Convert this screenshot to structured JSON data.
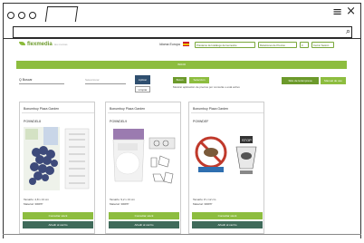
{
  "browser": {
    "menu_glyph": "≡",
    "close_glyph": "×",
    "search_glyph": "⌕"
  },
  "header": {
    "logo_text": "flexmedia",
    "tagline": "las marcas",
    "lang_label": "Idioma Europa",
    "buttons": [
      "Préstamo del catálogo del semestre",
      "Relaciones de Precios",
      "0",
      "Cerrar Sesión"
    ]
  },
  "banner_title": "INICIO",
  "filters": {
    "search_label": "Q  Buscar",
    "category_placeholder": "Seleccionar",
    "apply_label": "Aplicar",
    "clear_label": "Limpiar"
  },
  "actions": {
    "btn_a": "Boton",
    "btn_b": "Selección",
    "info_text": "Mostrar aplicación de precios por consulta o está activo",
    "btn_c": "Sitio de la Empresa",
    "btn_d": "Manual de uso"
  },
  "cards": [
    {
      "brand": "Bonumbuy Plaza Garden",
      "code": "PG9WDEL8",
      "size": "Tamaño: 4,8 x 13 cm",
      "material": "Material: 300PP",
      "btn_primary": "Consultar stock",
      "btn_secondary": "Añadir al carrito"
    },
    {
      "brand": "Bonumbuy Plaza Garden",
      "code": "PG9WDEL9",
      "size": "Tamaño: 9,2 x 13 cm",
      "material": "Material: 300PP",
      "btn_primary": "Consultar stock",
      "btn_secondary": "Añadir al carrito"
    },
    {
      "brand": "Bonumbuy Plaza Garden",
      "code": "PG9WDEF",
      "size": "Tamaño: 8 x 12 cm",
      "material": "Material: 300PP",
      "btn_primary": "Consultar stock",
      "btn_secondary": "Añadir al carrito"
    }
  ],
  "colors": {
    "brand_green": "#8dbd3f",
    "dark_green": "#6c9a2b",
    "teal": "#3f6a5a",
    "navy": "#2f4f6f"
  }
}
